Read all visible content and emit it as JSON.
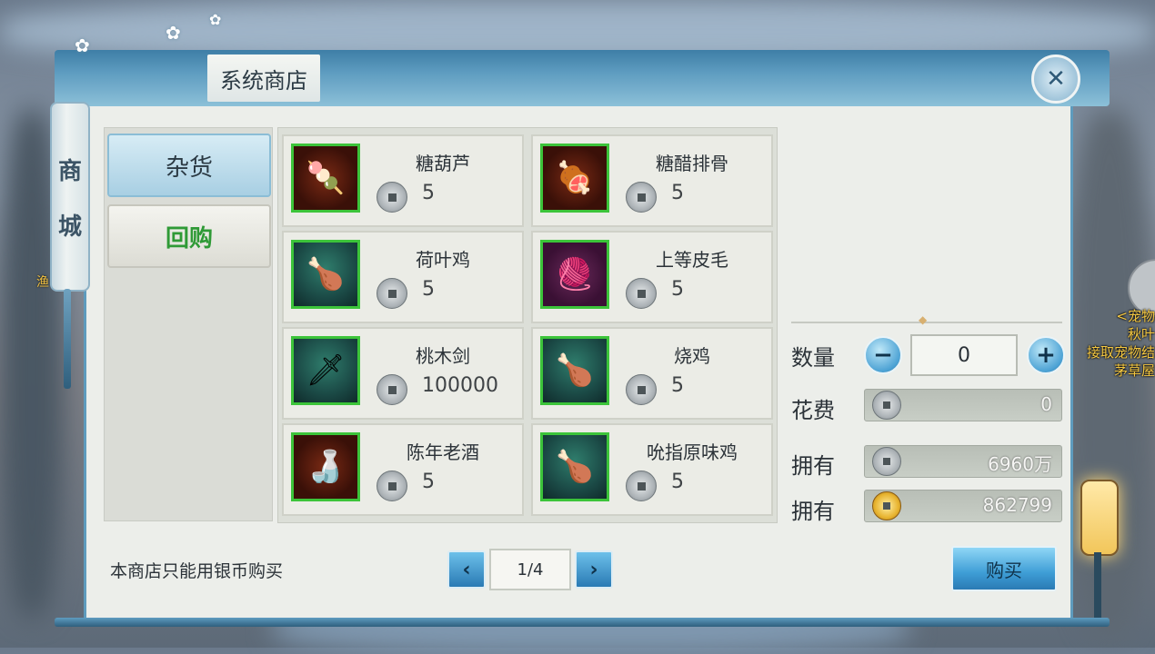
{
  "shop": {
    "title": "系统商店",
    "close_icon": "✕",
    "scroll_chars": [
      "商",
      "城"
    ],
    "categories": [
      {
        "label": "杂货",
        "active": true
      },
      {
        "label": "回购",
        "active": false
      }
    ],
    "items": [
      {
        "name": "糖葫芦",
        "price": "5",
        "icon": "candied-haws-icon",
        "glyph": "🍡"
      },
      {
        "name": "糖醋排骨",
        "price": "5",
        "icon": "sweet-sour-ribs-icon",
        "glyph": "🍖"
      },
      {
        "name": "荷叶鸡",
        "price": "5",
        "icon": "lotus-leaf-chicken-icon",
        "glyph": "🍗"
      },
      {
        "name": "上等皮毛",
        "price": "5",
        "icon": "fine-fur-icon",
        "glyph": "🧶"
      },
      {
        "name": "桃木剑",
        "price": "100000",
        "icon": "peach-wood-sword-icon",
        "glyph": "🗡"
      },
      {
        "name": "烧鸡",
        "price": "5",
        "icon": "roast-chicken-icon",
        "glyph": "🍗"
      },
      {
        "name": "陈年老酒",
        "price": "5",
        "icon": "aged-wine-icon",
        "glyph": "🍶"
      },
      {
        "name": "吮指原味鸡",
        "price": "5",
        "icon": "finger-licking-chicken-icon",
        "glyph": "🍗"
      }
    ],
    "purchase": {
      "qty_label": "数量",
      "qty_value": "0",
      "minus": "−",
      "plus": "+",
      "cost_label": "花费",
      "cost_value": "0",
      "own_label_1": "拥有",
      "own_silver": "6960万",
      "own_label_2": "拥有",
      "own_gold": "862799",
      "buy_label": "购买"
    },
    "notice": "本商店只能用银币购买",
    "pagination": {
      "prev": "‹",
      "next": "›",
      "page": "1/4"
    }
  },
  "side": {
    "left_text": "渔",
    "right_lines": [
      "<宠物",
      "秋叶",
      "接取宠物结",
      "茅草屋"
    ]
  },
  "colors": {
    "accent_blue": "#5e9bbd",
    "item_border_green": "#3cc43a",
    "repurchase_green": "#2f9a36"
  }
}
